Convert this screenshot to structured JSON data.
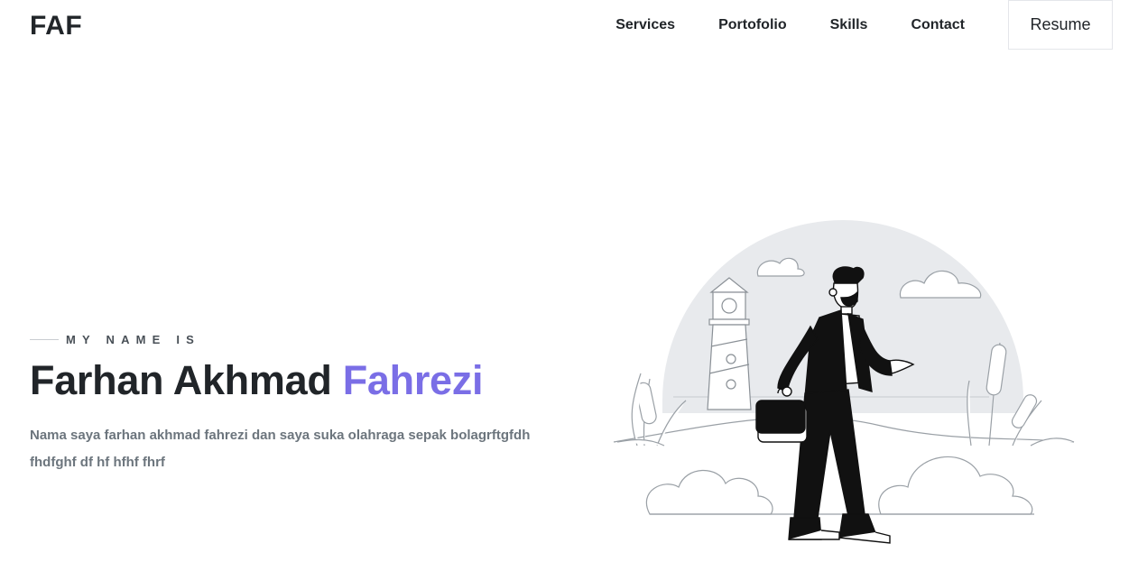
{
  "header": {
    "brand": "FAF",
    "nav": [
      {
        "label": "Services"
      },
      {
        "label": "Portofolio"
      },
      {
        "label": "Skills"
      },
      {
        "label": "Contact"
      }
    ],
    "resume_label": "Resume"
  },
  "hero": {
    "kicker": "MY NAME IS",
    "name_first": "Farhan Akhmad",
    "name_accent": "Fahrezi",
    "description": "Nama saya farhan akhmad fahrezi dan saya suka olahraga sepak bolagrftgfdh fhdfghf df hf hfhf fhrf"
  },
  "colors": {
    "accent": "#7a6ee6",
    "text": "#212529",
    "muted": "#6c757d"
  },
  "icons": [
    "man-with-briefcase-illustration",
    "lighthouse-icon",
    "cloud-icon",
    "bush-icon",
    "cattail-icon"
  ]
}
